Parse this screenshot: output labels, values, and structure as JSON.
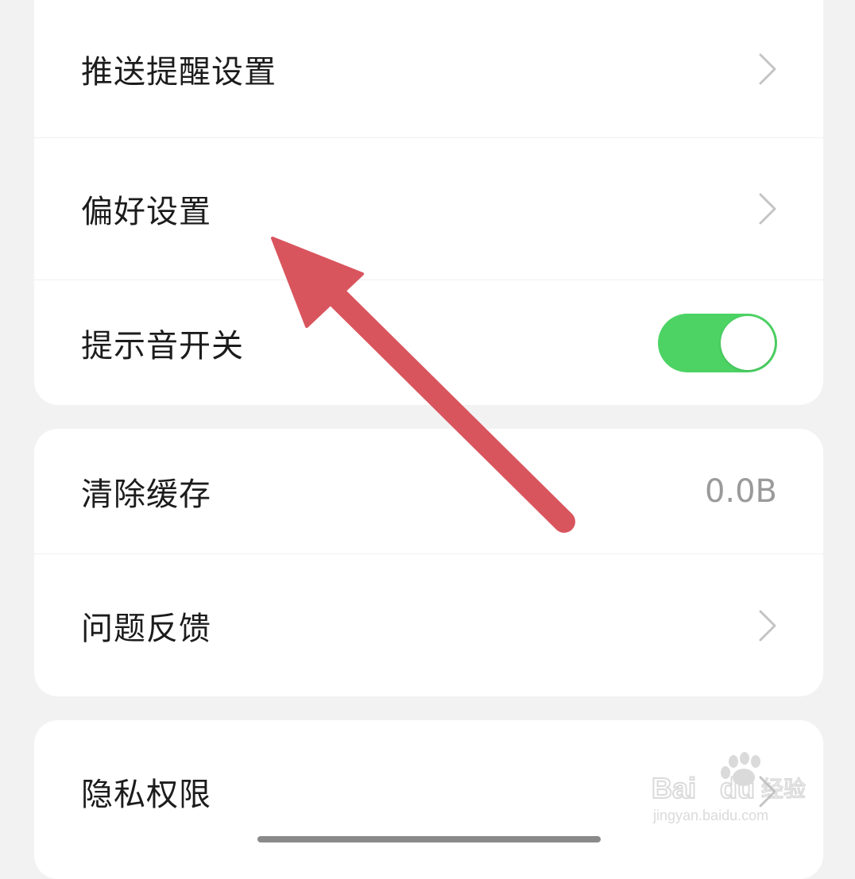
{
  "settings": {
    "group1": {
      "push_reminder": {
        "label": "推送提醒设置"
      },
      "preferences": {
        "label": "偏好设置"
      },
      "sound_toggle": {
        "label": "提示音开关",
        "enabled": true
      }
    },
    "group2": {
      "clear_cache": {
        "label": "清除缓存",
        "value": "0.0B"
      },
      "feedback": {
        "label": "问题反馈"
      }
    },
    "group3": {
      "privacy": {
        "label": "隐私权限"
      }
    }
  },
  "watermark": {
    "brand": "Baidu经验",
    "url": "jingyan.baidu.com"
  },
  "icons": {
    "chevron": "chevron-right-icon",
    "annotation": "arrow-annotation"
  },
  "colors": {
    "toggle_on": "#4cd364",
    "annotation_arrow": "#d9555e",
    "background": "#f2f2f2"
  }
}
